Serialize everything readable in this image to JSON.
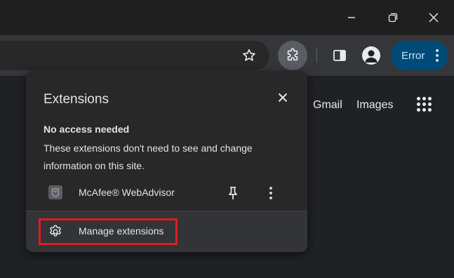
{
  "titlebar": {
    "buttons": [
      {
        "name": "minimize",
        "icon": "minimize-icon"
      },
      {
        "name": "restore",
        "icon": "restore-icon"
      },
      {
        "name": "close",
        "icon": "close-icon"
      }
    ]
  },
  "toolbar": {
    "icons": [
      "star-icon",
      "extensions-puzzle-icon",
      "side-panel-icon",
      "profile-icon",
      "more-vert-icon"
    ],
    "error_label": "Error",
    "error_color": "#004a77"
  },
  "page": {
    "links": [
      "Gmail",
      "Images"
    ],
    "apps_icon": "apps-grid-icon"
  },
  "popup": {
    "title": "Extensions",
    "section_title": "No access needed",
    "section_description": "These extensions don't need to see and change information on this site.",
    "extensions": [
      {
        "name": "McAfee® WebAdvisor",
        "icon": "mcafee-icon"
      }
    ],
    "manage_label": "Manage extensions",
    "highlight_color": "#e5191f"
  }
}
